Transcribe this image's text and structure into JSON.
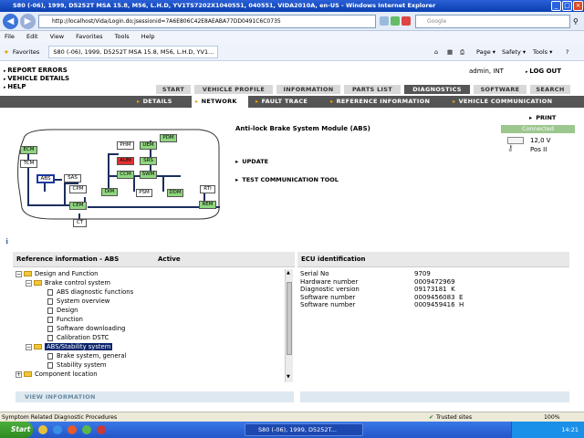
{
  "window": {
    "title": "S80 (-06), 1999, D5252T MSA 15.8, M56, L.H.D, YV1TS7202X1040551, 040551, VIDA2010A, en-US - Windows Internet Explorer"
  },
  "browser": {
    "address": "http://localhost/Vida/Login.do;jsessionid=7A6E806C42E8AEABA77DD0491C6C0735",
    "search_placeholder": "Google",
    "menu": [
      "File",
      "Edit",
      "View",
      "Favorites",
      "Tools",
      "Help"
    ],
    "favorites_label": "Favorites",
    "tab_title": "S80 (-06), 1999, D5252T MSA 15.8, M56, L.H.D, YV1...",
    "tools": [
      "Page ▾",
      "Safety ▾",
      "Tools ▾"
    ]
  },
  "app": {
    "top_links": [
      "REPORT ERRORS",
      "VEHICLE DETAILS",
      "HELP"
    ],
    "user": "admin, INT",
    "logout": "LOG OUT",
    "tabs": [
      "START",
      "VEHICLE PROFILE",
      "INFORMATION",
      "PARTS LIST",
      "DIAGNOSTICS",
      "SOFTWARE",
      "SEARCH"
    ],
    "active_tab": "DIAGNOSTICS",
    "subtabs": [
      "DETAILS",
      "NETWORK",
      "FAULT TRACE",
      "REFERENCE INFORMATION",
      "VEHICLE COMMUNICATION"
    ],
    "active_subtab": "NETWORK",
    "print": "PRINT",
    "status": {
      "connected": "Connected",
      "voltage": "12,0 V",
      "key_position": "Pos II"
    }
  },
  "network": {
    "nodes": [
      {
        "label": "ECM",
        "state": "green"
      },
      {
        "label": "TCM",
        "state": "white"
      },
      {
        "label": "ABS",
        "state": "selected"
      },
      {
        "label": "SAS",
        "state": "white"
      },
      {
        "label": "PHM",
        "state": "white"
      },
      {
        "label": "PDM",
        "state": "green"
      },
      {
        "label": "UEM",
        "state": "green"
      },
      {
        "label": "AUM",
        "state": "red"
      },
      {
        "label": "SRS",
        "state": "green"
      },
      {
        "label": "CCM",
        "state": "green"
      },
      {
        "label": "SWM",
        "state": "green"
      },
      {
        "label": "CPM",
        "state": "white"
      },
      {
        "label": "DIM",
        "state": "green"
      },
      {
        "label": "PSM",
        "state": "white"
      },
      {
        "label": "DDM",
        "state": "green"
      },
      {
        "label": "RTI",
        "state": "white"
      },
      {
        "label": "CEM",
        "state": "green"
      },
      {
        "label": "REM",
        "state": "green"
      },
      {
        "label": "CT",
        "state": "white"
      }
    ]
  },
  "module": {
    "title": "Anti-lock Brake System Module (ABS)",
    "actions": [
      "UPDATE",
      "TEST COMMUNICATION TOOL"
    ]
  },
  "reference": {
    "header": "Reference information - ABS",
    "status": "Active",
    "tree": [
      {
        "label": "Design and Function",
        "type": "folder",
        "level": 0,
        "exp": "−"
      },
      {
        "label": "Brake control system",
        "type": "folder",
        "level": 1,
        "exp": "−"
      },
      {
        "label": "ABS diagnostic functions",
        "type": "doc",
        "level": 2
      },
      {
        "label": "System overview",
        "type": "doc",
        "level": 2
      },
      {
        "label": "Design",
        "type": "doc",
        "level": 2
      },
      {
        "label": "Function",
        "type": "doc",
        "level": 2
      },
      {
        "label": "Software downloading",
        "type": "doc",
        "level": 2
      },
      {
        "label": "Calibration DSTC",
        "type": "doc",
        "level": 2
      },
      {
        "label": "ABS/Stability system",
        "type": "folder",
        "level": 1,
        "exp": "−",
        "selected": true
      },
      {
        "label": "Brake system, general",
        "type": "doc",
        "level": 2
      },
      {
        "label": "Stability system",
        "type": "doc",
        "level": 2
      },
      {
        "label": "Component location",
        "type": "folder",
        "level": 0,
        "exp": "+"
      }
    ],
    "view_info": "VIEW INFORMATION"
  },
  "ecu": {
    "header": "ECU identification",
    "rows": [
      {
        "key": "Serial No",
        "value": "9709"
      },
      {
        "key": "Hardware number",
        "value": "0009472969"
      },
      {
        "key": "Diagnostic version",
        "value": "09173181  K"
      },
      {
        "key": "Software number",
        "value": "0009456083  E"
      },
      {
        "key": "Software number",
        "value": "0009459416  H"
      }
    ]
  },
  "statusbar": {
    "left": "Symptom Related Diagnostic Procedures",
    "zone": "Trusted sites",
    "zoom": "100%"
  },
  "taskbar": {
    "start": "Start",
    "window": "S80 (-06), 1999, D5252T...",
    "clock": "14:21"
  }
}
